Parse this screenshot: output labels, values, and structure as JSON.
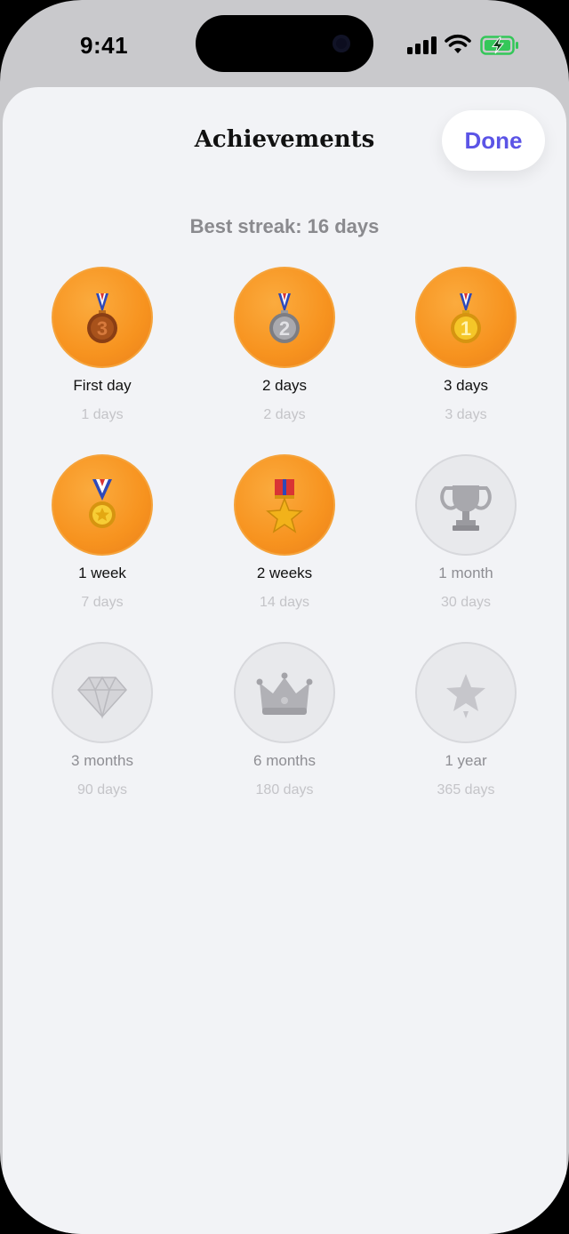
{
  "status_bar": {
    "time": "9:41",
    "icons": [
      "cellular-signal-icon",
      "wifi-icon",
      "battery-charging-icon"
    ],
    "battery_color": "#34c759"
  },
  "sheet": {
    "title": "Achievements",
    "done_label": "Done",
    "accent_color": "#5b54e6",
    "best_streak": "Best streak: 16 days"
  },
  "achievements": [
    {
      "title": "First day",
      "subtitle": "1 days",
      "icon": "bronze-medal-icon",
      "earned": true
    },
    {
      "title": "2 days",
      "subtitle": "2 days",
      "icon": "silver-medal-icon",
      "earned": true
    },
    {
      "title": "3 days",
      "subtitle": "3 days",
      "icon": "gold-medal-icon",
      "earned": true
    },
    {
      "title": "1 week",
      "subtitle": "7 days",
      "icon": "sports-medal-icon",
      "earned": true
    },
    {
      "title": "2 weeks",
      "subtitle": "14 days",
      "icon": "military-medal-icon",
      "earned": true
    },
    {
      "title": "1 month",
      "subtitle": "30 days",
      "icon": "trophy-icon",
      "earned": false
    },
    {
      "title": "3 months",
      "subtitle": "90 days",
      "icon": "gem-icon",
      "earned": false
    },
    {
      "title": "6 months",
      "subtitle": "180 days",
      "icon": "crown-icon",
      "earned": false
    },
    {
      "title": "1 year",
      "subtitle": "365 days",
      "icon": "glowing-star-icon",
      "earned": false
    }
  ],
  "colors": {
    "earned_badge": "#f7931f",
    "locked_badge": "#e8e9ec",
    "sheet_background": "#f2f3f6"
  }
}
